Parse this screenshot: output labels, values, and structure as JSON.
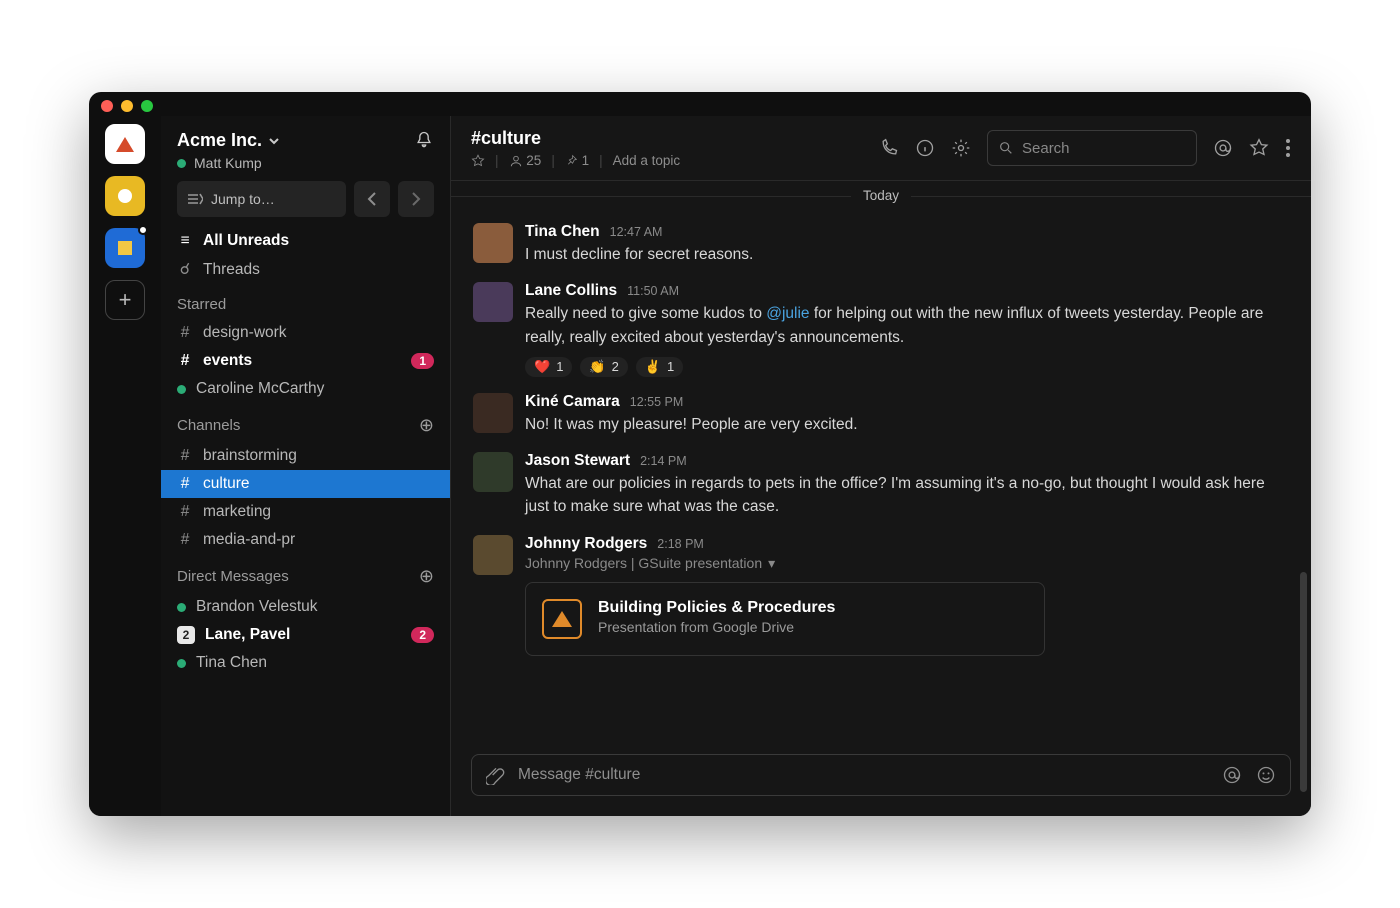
{
  "workspace": {
    "name": "Acme Inc.",
    "user": "Matt Kump"
  },
  "sidebar": {
    "jump": "Jump to…",
    "all_unreads": "All Unreads",
    "threads": "Threads",
    "sections": {
      "starred": {
        "title": "Starred",
        "items": [
          {
            "type": "channel",
            "label": "design-work",
            "bold": false
          },
          {
            "type": "channel",
            "label": "events",
            "bold": true,
            "badge": "1"
          },
          {
            "type": "dm",
            "label": "Caroline McCarthy",
            "presence": "active"
          }
        ]
      },
      "channels": {
        "title": "Channels",
        "items": [
          {
            "label": "brainstorming"
          },
          {
            "label": "culture",
            "selected": true
          },
          {
            "label": "marketing"
          },
          {
            "label": "media-and-pr"
          }
        ]
      },
      "dms": {
        "title": "Direct Messages",
        "items": [
          {
            "label": "Brandon Velestuk",
            "presence": "active"
          },
          {
            "label": "Lane, Pavel",
            "bold": true,
            "count": "2",
            "badge": "2"
          },
          {
            "label": "Tina Chen",
            "presence": "active"
          }
        ]
      }
    }
  },
  "channel": {
    "name": "#culture",
    "members": "25",
    "pins": "1",
    "topic_cta": "Add a topic",
    "search_placeholder": "Search",
    "date": "Today"
  },
  "messages": [
    {
      "author": "Tina Chen",
      "time": "12:47 AM",
      "avatar": "#8a5c3c",
      "text": "I must decline for secret reasons."
    },
    {
      "author": "Lane Collins",
      "time": "11:50 AM",
      "avatar": "#4a3a5a",
      "text_pre": "Really need to give some kudos to ",
      "mention": "@julie",
      "text_post": " for helping out with the new influx of tweets yesterday. People are really, really excited about yesterday's announcements.",
      "reactions": [
        {
          "emoji": "❤️",
          "count": "1"
        },
        {
          "emoji": "👏",
          "count": "2"
        },
        {
          "emoji": "✌️",
          "count": "1"
        }
      ]
    },
    {
      "author": "Kiné Camara",
      "time": "12:55 PM",
      "avatar": "#3a2a22",
      "text": "No! It was my pleasure! People are very excited."
    },
    {
      "author": "Jason Stewart",
      "time": "2:14 PM",
      "avatar": "#2f3a2a",
      "text": "What are our policies in regards to pets in the office? I'm assuming it's a no-go, but thought I would ask here just to make sure what was the case."
    },
    {
      "author": "Johnny Rodgers",
      "time": "2:18 PM",
      "avatar": "#5a4a2f",
      "subline": "Johnny Rodgers | GSuite presentation",
      "attachment": {
        "title": "Building Policies & Procedures",
        "subtitle": "Presentation from Google Drive"
      }
    }
  ],
  "composer": {
    "placeholder": "Message #culture"
  }
}
